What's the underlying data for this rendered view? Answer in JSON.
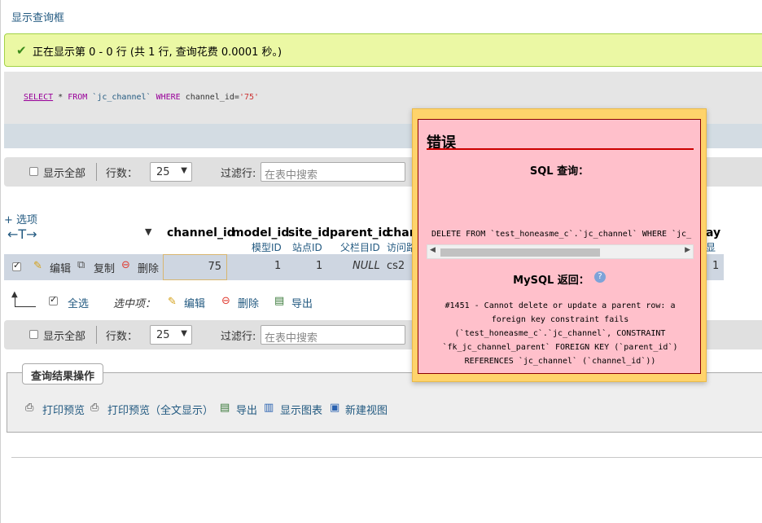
{
  "page": {
    "top_link": "显示查询框"
  },
  "success": {
    "message": "正在显示第 0 - 0 行 (共 1 行, 查询花费 0.0001 秒。)"
  },
  "sql": {
    "select": "SELECT",
    "star": " * ",
    "from": "FROM",
    "table": " `jc_channel` ",
    "where": "WHERE",
    "cond": " channel_id=",
    "value": "'75'"
  },
  "nav_top": {
    "show_all": "显示全部",
    "rows_label": "行数：",
    "rows_value": "25",
    "filter_label": "过滤行:",
    "filter_placeholder": "在表中搜索"
  },
  "options_link": "+ 选项",
  "table": {
    "arrows": "←T→",
    "sort_marker": "▼",
    "columns": [
      {
        "name": "channel_id",
        "sub": ""
      },
      {
        "name": "model_id",
        "sub": "模型ID"
      },
      {
        "name": "site_id",
        "sub": "站点ID"
      },
      {
        "name": "parent_id",
        "sub": "父栏目ID"
      },
      {
        "name": "chan",
        "sub": "访问路"
      },
      {
        "name": "ay",
        "sub": "显示"
      }
    ],
    "row": {
      "edit": "编辑",
      "copy": "复制",
      "delete": "删除",
      "channel_id": "75",
      "model_id": "1",
      "site_id": "1",
      "parent_id": "NULL",
      "chan": "cs2",
      "last": "1"
    }
  },
  "bulk": {
    "select_all": "全选",
    "with_selected": "选中项：",
    "edit": "编辑",
    "delete": "删除",
    "export": "导出"
  },
  "nav_bottom": {
    "show_all": "显示全部",
    "rows_label": "行数：",
    "rows_value": "25",
    "filter_label": "过滤行:",
    "filter_placeholder": "在表中搜索"
  },
  "query_ops": {
    "legend": "查询结果操作",
    "items": [
      "打印预览",
      "打印预览（全文显示）",
      "导出",
      "显示图表",
      "新建视图"
    ]
  },
  "error": {
    "title": "错误",
    "sql_heading": "SQL 查询：",
    "sql_text": "DELETE FROM `test_honeasme_c`.`jc_channel` WHERE `jc_",
    "mysql_heading": "MySQL 返回：",
    "message_lines": [
      "#1451 - Cannot delete or update a parent row: a",
      "foreign key constraint fails",
      "(`test_honeasme_c`.`jc_channel`, CONSTRAINT",
      "`fk_jc_channel_parent` FOREIGN KEY (`parent_id`)",
      "REFERENCES `jc_channel` (`channel_id`))"
    ]
  },
  "colors": {
    "success_bg": "#ebf8a4",
    "error_bg": "#ffc0cb",
    "popup_border": "#ffd36b",
    "link": "#235a81",
    "row_bg": "#ced6e1"
  }
}
